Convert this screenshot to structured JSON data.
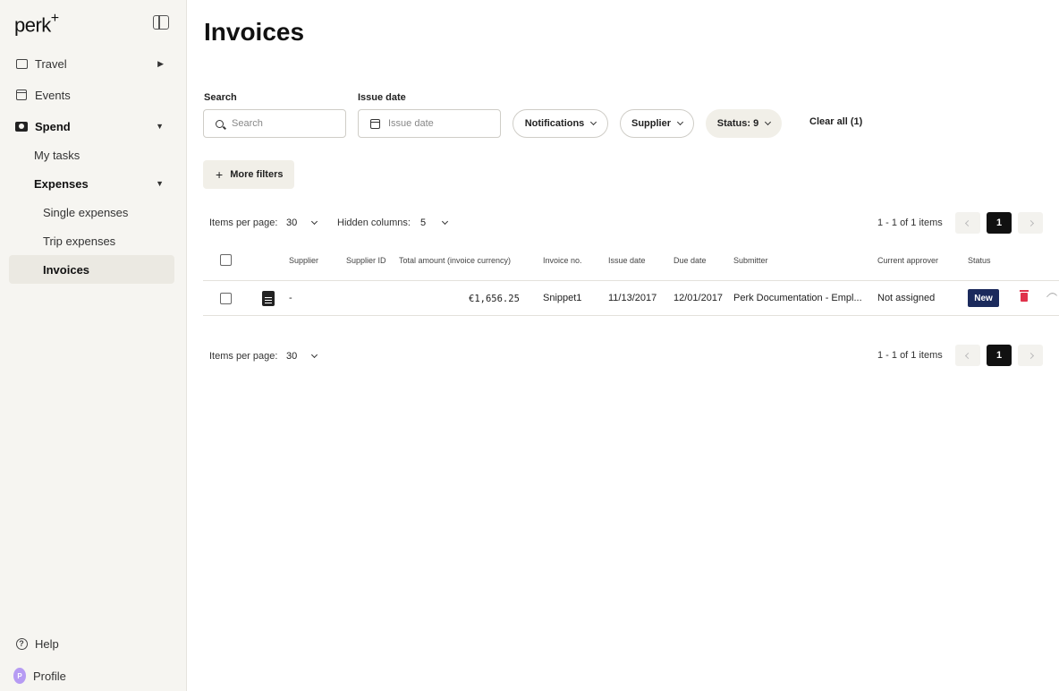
{
  "app": {
    "logo": "perk",
    "logo_sup": "+"
  },
  "sidebar": {
    "items": [
      {
        "label": "Travel"
      },
      {
        "label": "Events"
      },
      {
        "label": "Spend"
      },
      {
        "label": "My tasks"
      },
      {
        "label": "Expenses"
      },
      {
        "label": "Single expenses"
      },
      {
        "label": "Trip expenses"
      },
      {
        "label": "Invoices"
      }
    ],
    "bottom": {
      "help": "Help",
      "profile": "Profile",
      "avatar_initial": "P"
    }
  },
  "page": {
    "title": "Invoices"
  },
  "filters": {
    "search_label": "Search",
    "search_placeholder": "Search",
    "issue_date_label": "Issue date",
    "issue_date_placeholder": "Issue date",
    "notifications": "Notifications",
    "supplier": "Supplier",
    "status": "Status: 9",
    "clear_all": "Clear all (1)",
    "more_filters": "More filters"
  },
  "controls": {
    "items_per_page_label": "Items per page:",
    "items_per_page_value": "30",
    "hidden_columns_label": "Hidden columns:",
    "hidden_columns_value": "5",
    "range_text": "1 - 1 of 1 items",
    "current_page": "1"
  },
  "table": {
    "columns": [
      "Supplier",
      "Supplier ID",
      "Total amount (invoice currency)",
      "Invoice no.",
      "Issue date",
      "Due date",
      "Submitter",
      "Current approver",
      "Status"
    ],
    "rows": [
      {
        "supplier": "-",
        "supplier_id": "",
        "total_amount": "€1,656.25",
        "invoice_no": "Snippet1",
        "issue_date": "11/13/2017",
        "due_date": "12/01/2017",
        "submitter": "Perk Documentation - Empl...",
        "current_approver": "Not assigned",
        "status": "New"
      }
    ]
  },
  "colors": {
    "sidebar_bg": "#f6f5f1",
    "status_badge": "#1b2a5c",
    "delete": "#e0324b",
    "avatar": "#b69bf3"
  }
}
